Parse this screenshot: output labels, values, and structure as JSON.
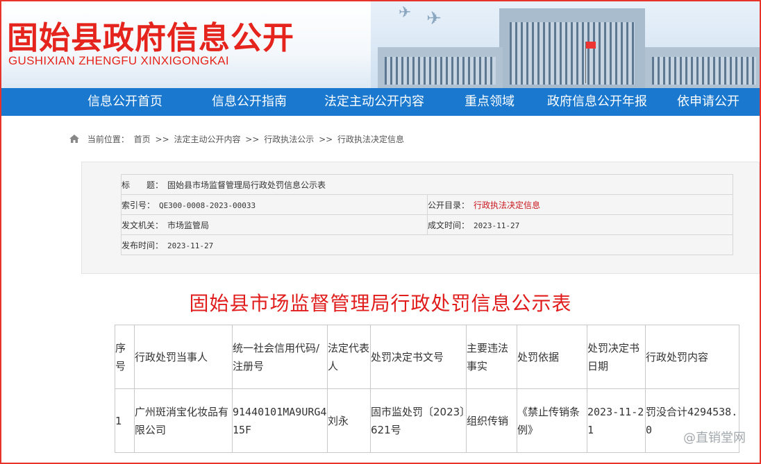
{
  "site": {
    "title_cn": "固始县政府信息公开",
    "title_en": "GUSHIXIAN ZHENGFU XINXIGONGKAI"
  },
  "nav": [
    "信息公开首页",
    "信息公开指南",
    "法定主动公开内容",
    "重点领域",
    "政府信息公开年报",
    "依申请公开"
  ],
  "breadcrumb": {
    "prefix": "当前位置：",
    "items": [
      "首页",
      ">>",
      "法定主动公开内容",
      ">>",
      "行政执法公示",
      ">>",
      "行政执法决定信息"
    ]
  },
  "meta": {
    "title_label": "标　　题：",
    "title_value": "固始县市场监督管理局行政处罚信息公示表",
    "index_label": "索引号：",
    "index_value": "QE300-0008-2023-00033",
    "catalog_label": "公开目录：",
    "catalog_value": "行政执法决定信息",
    "issuer_label": "发文机关：",
    "issuer_value": "市场监管局",
    "written_label": "成文时间：",
    "written_value": "2023-11-27",
    "published_label": "发布时间：",
    "published_value": "2023-11-27"
  },
  "document": {
    "title": "固始县市场监督管理局行政处罚信息公示表"
  },
  "table": {
    "headers": [
      "序号",
      "行政处罚当事人",
      "统一社会信用代码/注册号",
      "法定代表人",
      "处罚决定书文号",
      "主要违法事实",
      "处罚依据",
      "处罚决定书日期",
      "行政处罚内容"
    ],
    "rows": [
      [
        "1",
        "广州斑消宝化妆品有限公司",
        "91440101MA9URG415F",
        "刘永",
        "固市监处罚〔2023〕621号",
        "组织传销",
        "《禁止传销条例》",
        "2023-11-21",
        "罚没合计4294538.0"
      ]
    ]
  },
  "watermark": "@直销堂网",
  "colors": {
    "brand_red": "#e5251d",
    "nav_blue": "#1a79cf",
    "link_red": "#c8161d"
  }
}
